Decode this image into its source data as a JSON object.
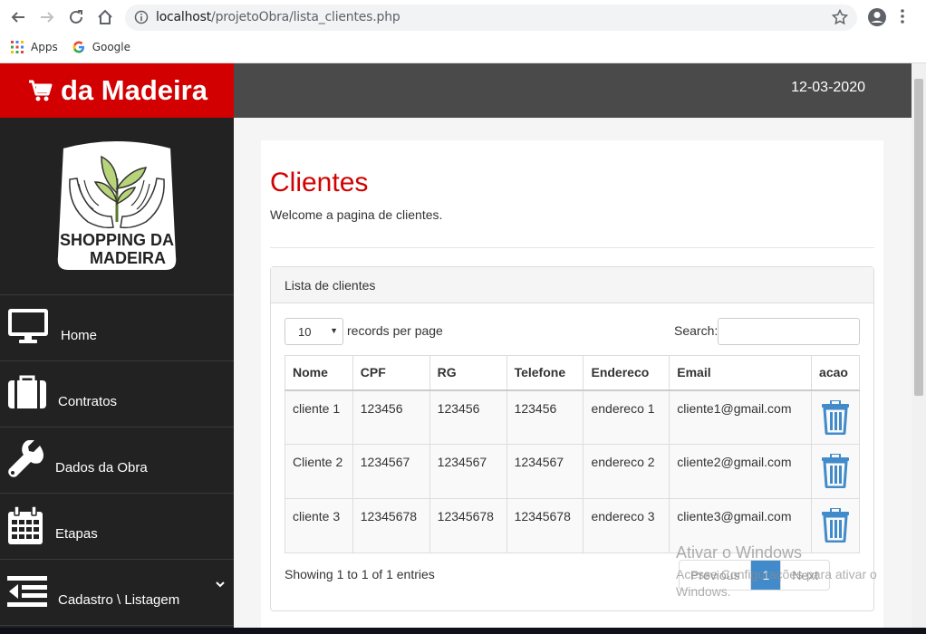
{
  "browser": {
    "url_host": "localhost",
    "url_path": "/projetoObra/lista_clientes.php",
    "bookmarks": [
      "Apps",
      "Google"
    ]
  },
  "brand": {
    "title": "da Madeira"
  },
  "logo": {
    "line1": "SHOPPING DA",
    "line2": "MADEIRA"
  },
  "header": {
    "date": "12-03-2020"
  },
  "sidebar": {
    "items": [
      {
        "label": "Home",
        "icon": "monitor-icon"
      },
      {
        "label": "Contratos",
        "icon": "briefcase-icon"
      },
      {
        "label": "Dados da Obra",
        "icon": "wrench-icon"
      },
      {
        "label": "Etapas",
        "icon": "calendar-icon"
      },
      {
        "label": "Cadastro \\ Listagem",
        "icon": "list-icon"
      }
    ]
  },
  "page": {
    "title": "Clientes",
    "welcome": "Welcome a pagina de clientes."
  },
  "panel": {
    "heading": "Lista de clientes"
  },
  "table_controls": {
    "length_value": "10",
    "length_label": "records per page",
    "search_label": "Search:"
  },
  "table": {
    "headers": [
      "Nome",
      "CPF",
      "RG",
      "Telefone",
      "Endereco",
      "Email",
      "acao"
    ],
    "rows": [
      {
        "nome": "cliente 1",
        "cpf": "123456",
        "rg": "123456",
        "telefone": "123456",
        "endereco": "endereco 1",
        "email": "cliente1@gmail.com"
      },
      {
        "nome": "Cliente 2",
        "cpf": "1234567",
        "rg": "1234567",
        "telefone": "1234567",
        "endereco": "endereco 2",
        "email": "cliente2@gmail.com"
      },
      {
        "nome": "cliente 3",
        "cpf": "12345678",
        "rg": "12345678",
        "telefone": "12345678",
        "endereco": "endereco 3",
        "email": "cliente3@gmail.com"
      }
    ]
  },
  "footer": {
    "info": "Showing 1 to 1 of 1 entries",
    "prev": "Previous",
    "page": "1",
    "next": "Next"
  },
  "watermark": {
    "line1": "Ativar o Windows",
    "line2": "Acesse Configurações para ativar o Windows."
  },
  "colors": {
    "accent_red": "#d20000",
    "sidebar_bg": "#222222",
    "trash_blue": "#428bca"
  }
}
